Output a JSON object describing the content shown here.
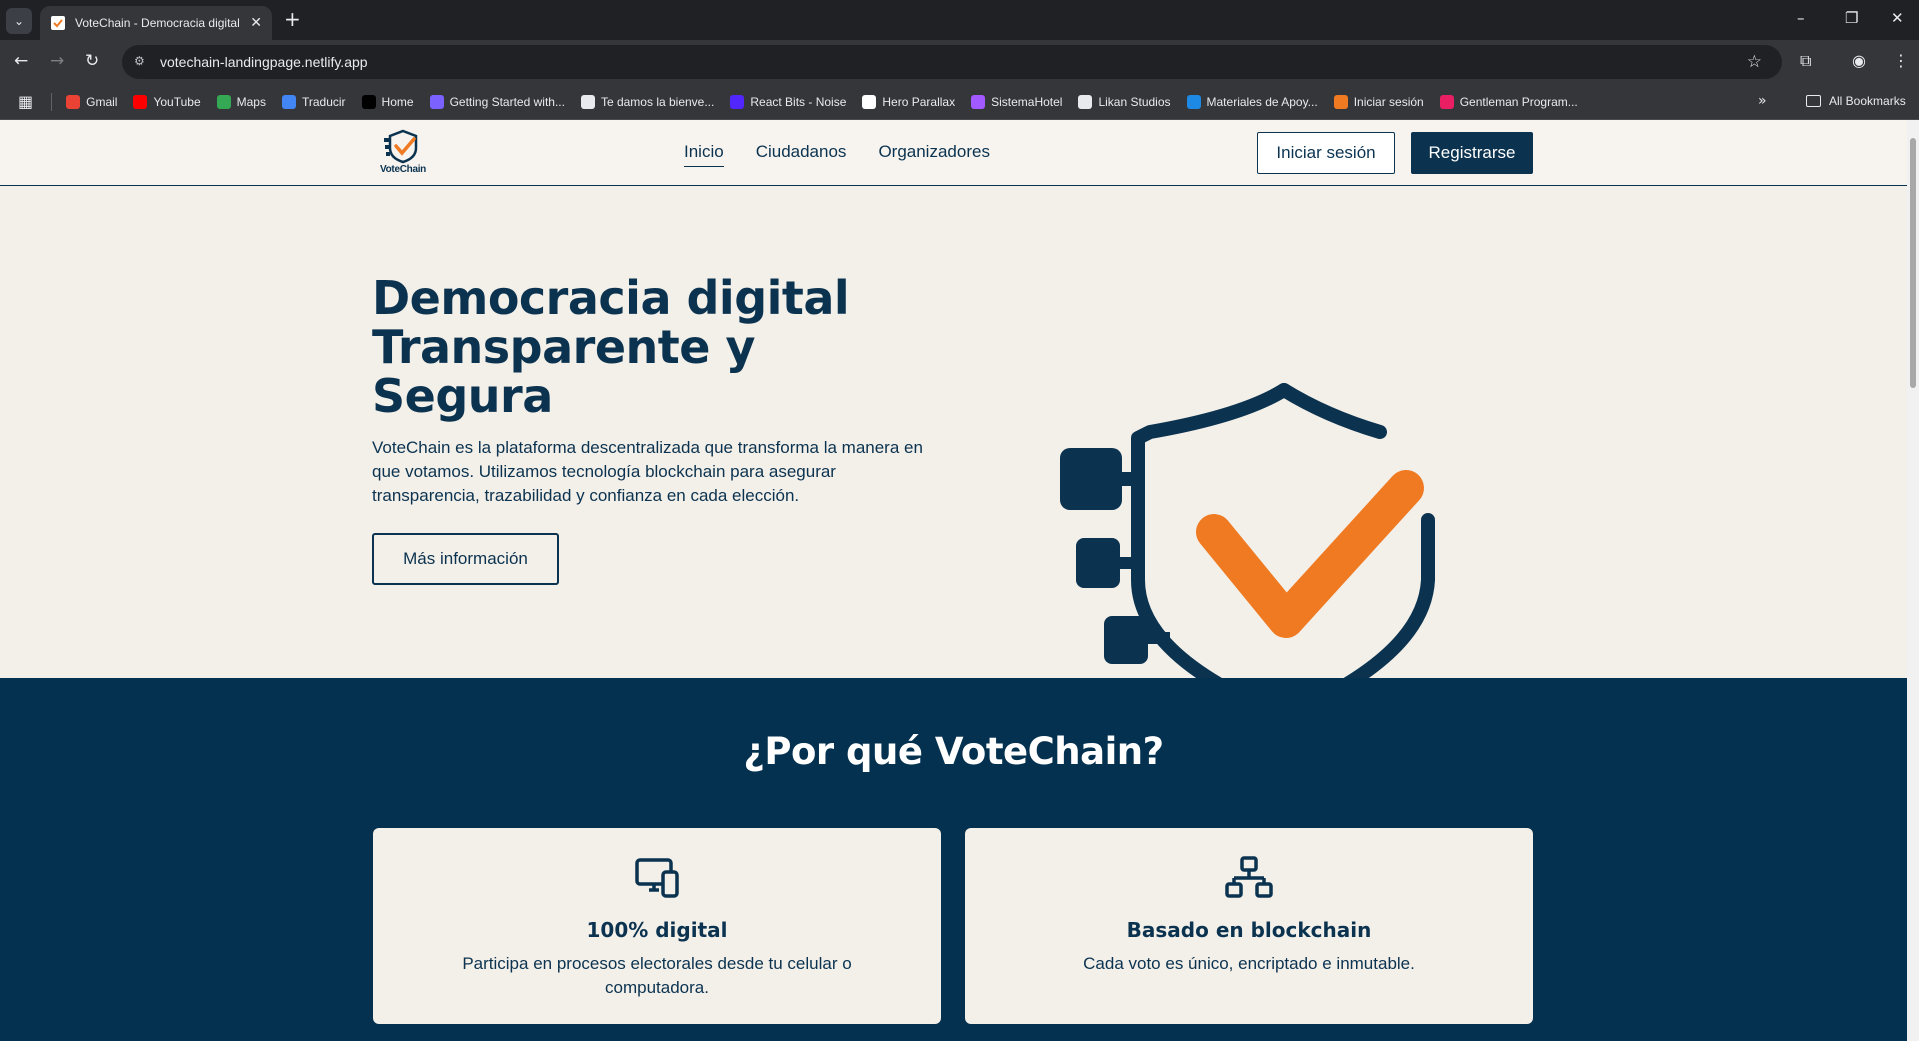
{
  "browser": {
    "tab": {
      "title": "VoteChain - Democracia digital",
      "close": "✕"
    },
    "new_tab": "+",
    "window": {
      "minimize": "–",
      "restore": "❐",
      "close": "✕"
    },
    "url": "votechain-landingpage.netlify.app",
    "bookmarks": [
      {
        "label": "Gmail",
        "color": "#ea4335"
      },
      {
        "label": "YouTube",
        "color": "#ff0000"
      },
      {
        "label": "Maps",
        "color": "#34a853"
      },
      {
        "label": "Traducir",
        "color": "#4285f4"
      },
      {
        "label": "Home",
        "color": "#000000"
      },
      {
        "label": "Getting Started with...",
        "color": "#7b61ff"
      },
      {
        "label": "Te damos la bienve...",
        "color": "#e8eaed"
      },
      {
        "label": "React Bits - Noise",
        "color": "#5227ff"
      },
      {
        "label": "Hero Parallax",
        "color": "#ffffff"
      },
      {
        "label": "SistemaHotel",
        "color": "#a259ff"
      },
      {
        "label": "Likan Studios",
        "color": "#e8eaed"
      },
      {
        "label": "Materiales de Apoy...",
        "color": "#1e88e5"
      },
      {
        "label": "Iniciar sesión",
        "color": "#f07a22"
      },
      {
        "label": "Gentleman Program...",
        "color": "#e91e63"
      }
    ],
    "all_bookmarks": "All Bookmarks",
    "more_bookmarks": "»"
  },
  "site": {
    "logo_text": "VoteChain",
    "nav": [
      {
        "label": "Inicio",
        "active": true
      },
      {
        "label": "Ciudadanos",
        "active": false
      },
      {
        "label": "Organizadores",
        "active": false
      }
    ],
    "login_label": "Iniciar sesión",
    "register_label": "Registrarse"
  },
  "hero": {
    "title_line1": "Democracia digital",
    "title_line2": "Transparente y",
    "title_line3": "Segura",
    "description": "VoteChain es la plataforma descentralizada que transforma la manera en que votamos. Utilizamos tecnología blockchain para asegurar transparencia, trazabilidad y confianza en cada elección.",
    "cta_label": "Más información"
  },
  "why": {
    "title": "¿Por qué VoteChain?",
    "cards": [
      {
        "icon": "devices-icon",
        "title": "100% digital",
        "description": "Participa en procesos electorales desde tu celular o computadora."
      },
      {
        "icon": "network-icon",
        "title": "Basado en blockchain",
        "description": "Cada voto es único, encriptado e inmutable."
      }
    ]
  },
  "colors": {
    "navy": "#0b3350",
    "orange": "#f07a22",
    "cream": "#f3efe9",
    "section_bg": "#04314f"
  }
}
